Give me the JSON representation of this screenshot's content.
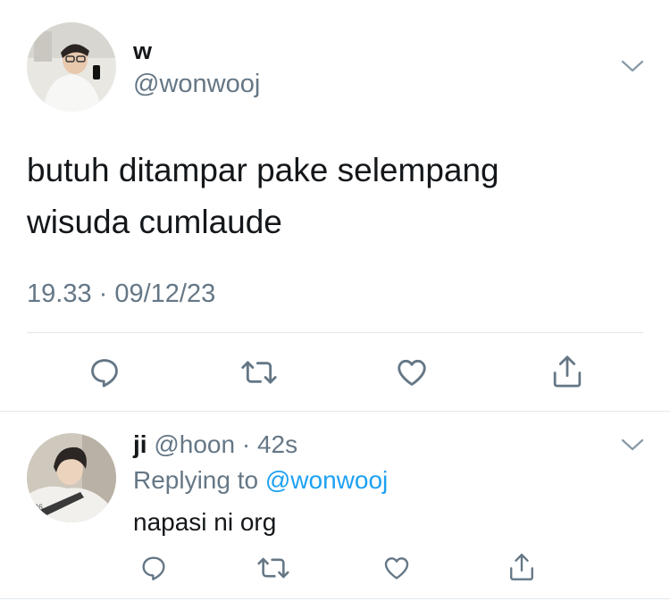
{
  "tweet": {
    "author_name": "w",
    "author_handle": "@wonwooj",
    "text_line1": "butuh ditampar pake selempang",
    "text_line2": "wisuda cumlaude",
    "timestamp": "19.33 · 09/12/23"
  },
  "reply": {
    "author_name": "ji",
    "author_handle": "@hoon",
    "separator": "·",
    "time": "42s",
    "replying_prefix": "Replying to",
    "replying_handle": "@wonwooj",
    "text": "napasi ni org"
  },
  "icons": {
    "reply": "reply-icon",
    "retweet": "retweet-icon",
    "like": "heart-icon",
    "share": "share-icon",
    "menu": "chevron-down-icon"
  },
  "colors": {
    "text": "#14171a",
    "secondary": "#657786",
    "accent": "#1da1f2",
    "divider": "#e1e8ed"
  }
}
